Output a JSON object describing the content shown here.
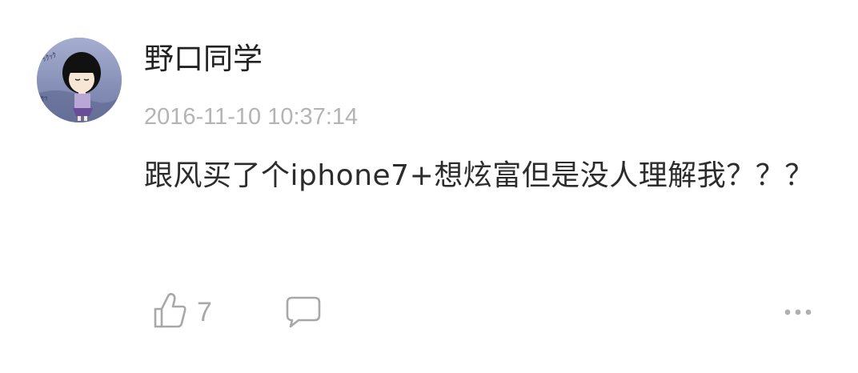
{
  "comment": {
    "username": "野口同学",
    "timestamp": "2016-11-10 10:37:14",
    "text": "跟风买了个iphone7+想炫富但是没人理解我？？？",
    "like_count": "7"
  },
  "icons": {
    "avatar": "avatar-image",
    "like": "thumbs-up-icon",
    "reply": "speech-bubble-icon",
    "more": "ellipsis-icon"
  },
  "colors": {
    "username": "#222222",
    "timestamp": "#b4b4b4",
    "text": "#2c2c2c",
    "icon_gray": "#a8a8a8"
  }
}
